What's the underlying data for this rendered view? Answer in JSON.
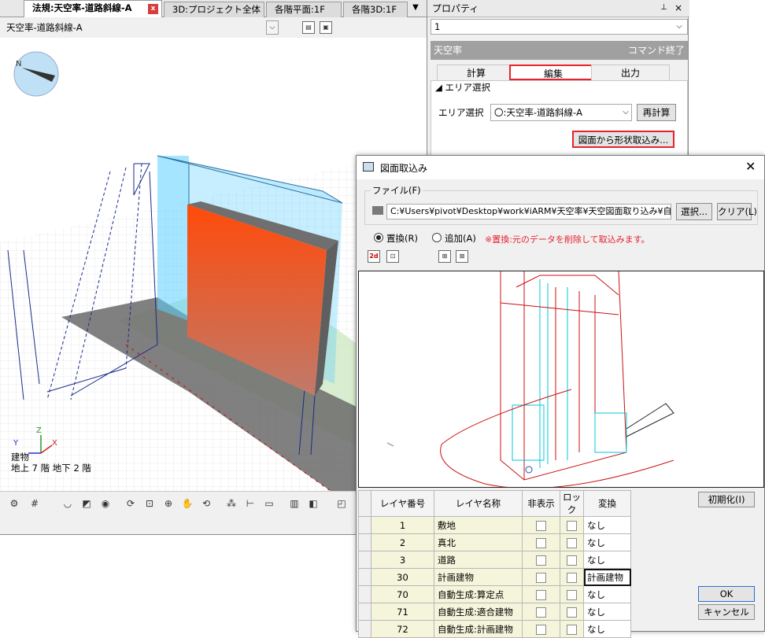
{
  "tabs": [
    {
      "label": "法規:天空率-道路斜線-A",
      "active": true
    },
    {
      "label": "3D:プロジェクト全体",
      "active": false
    },
    {
      "label": "各階平面:1F",
      "active": false
    },
    {
      "label": "各階3D:1F",
      "active": false
    }
  ],
  "view": {
    "selected": "天空率-道路斜線-A",
    "compass_label": "N",
    "axis_z": "Z",
    "axis_y": "Y",
    "axis_x": "X"
  },
  "status": {
    "line1": "建物",
    "line2": "地上 7 階  地下 2 階"
  },
  "properties": {
    "title": "プロパティ",
    "selected": "1",
    "header": "天空率",
    "header_status": "コマンド終了",
    "tabs": [
      "計算",
      "編集",
      "出力"
    ],
    "active_tab": "編集",
    "section": "◢ エリア選択",
    "area_label": "エリア選択",
    "area_value": "〇:天空率-道路斜線-A",
    "recalc_button": "再計算",
    "import_button": "図面から形状取込み..."
  },
  "dialog": {
    "title": "図面取込み",
    "file_label": "ファイル(F)",
    "file_path": "C:¥Users¥pivot¥Desktop¥work¥iARM¥天空率¥天空図面取り込み¥自動生成",
    "select_button": "選択...",
    "clear_button": "クリア(L)",
    "replace_label": "置換(R)",
    "add_label": "追加(A)",
    "note": "※置換:元のデータを削除して取込みます。",
    "init_button": "初期化(I)",
    "ok_button": "OK",
    "cancel_button": "キャンセル",
    "columns": [
      "レイヤ番号",
      "レイヤ名称",
      "非表示",
      "ロック",
      "変換"
    ],
    "layers": [
      {
        "num": "1",
        "name": "敷地",
        "convert": "なし"
      },
      {
        "num": "2",
        "name": "真北",
        "convert": "なし"
      },
      {
        "num": "3",
        "name": "道路",
        "convert": "なし"
      },
      {
        "num": "30",
        "name": "計画建物",
        "convert": "計画建物"
      },
      {
        "num": "70",
        "name": "自動生成:算定点",
        "convert": "なし"
      },
      {
        "num": "71",
        "name": "自動生成:適合建物",
        "convert": "なし"
      },
      {
        "num": "72",
        "name": "自動生成:計画建物",
        "convert": "なし"
      }
    ]
  },
  "colors": {
    "accent_red": "#e8222d",
    "building_orange": "#ff4a0a",
    "glass_cyan": "#5ccfff",
    "line_navy": "#1a2a8a"
  }
}
